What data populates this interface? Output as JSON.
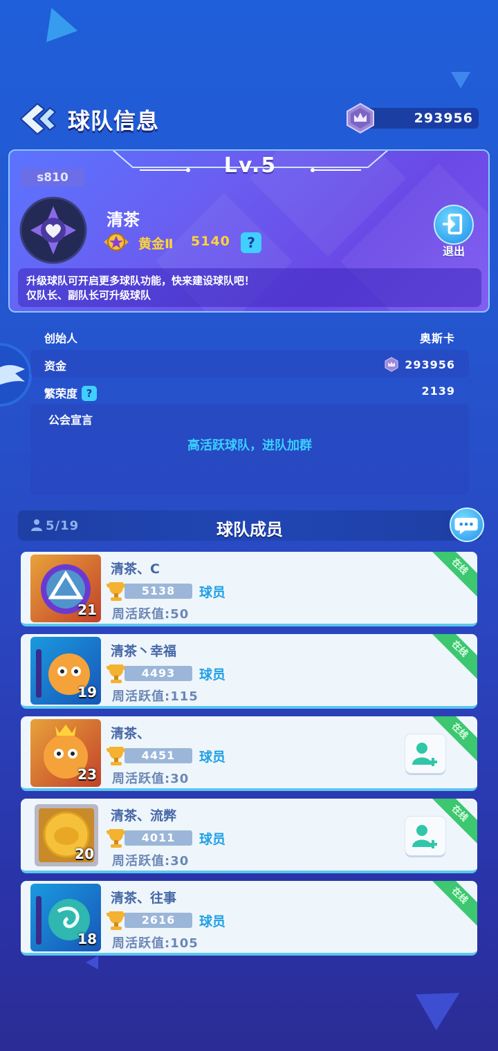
{
  "header": {
    "title": "球队信息",
    "currency_value": "293956"
  },
  "team": {
    "level": "Lv.5",
    "server": "s810",
    "name": "清茶",
    "rank_name": "黄金Ⅱ",
    "rank_score": "5140",
    "help_glyph": "?",
    "exit_label": "退出",
    "notice_lines": [
      "升级球队可开启更多球队功能，快来建设球队吧！",
      "仅队长、副队长可升级球队"
    ]
  },
  "info": {
    "founder_label": "创始人",
    "founder_value": "奥斯卡",
    "funds_label": "资金",
    "funds_value": "293956",
    "prosperity_label": "繁荣度",
    "prosperity_value": "2139",
    "manifesto_label": "公会宣言",
    "manifesto_text": "高活跃球队，进队加群"
  },
  "members_header": {
    "count": "5/19",
    "title": "球队成员"
  },
  "members": [
    {
      "name": "清茶、C",
      "score": "5138",
      "role": "球员",
      "activity": "周活跃值:50",
      "level": "21",
      "status": "在线",
      "avatar": "prism-emblem-icon",
      "show_add": false
    },
    {
      "name": "清茶丶幸福",
      "score": "4493",
      "role": "球员",
      "activity": "周活跃值:115",
      "level": "19",
      "status": "在线",
      "avatar": "tiger-guitar-icon",
      "show_add": false
    },
    {
      "name": "清茶、",
      "score": "4451",
      "role": "球员",
      "activity": "周活跃值:30",
      "level": "23",
      "status": "在线",
      "avatar": "tiger-crown-icon",
      "show_add": true
    },
    {
      "name": "清茶、流弊",
      "score": "4011",
      "role": "球员",
      "activity": "周活跃值:30",
      "level": "20",
      "status": "在线",
      "avatar": "golden-piggy-coin-icon",
      "show_add": true
    },
    {
      "name": "清茶、往事",
      "score": "2616",
      "role": "球员",
      "activity": "周活跃值:105",
      "level": "18",
      "status": "在线",
      "avatar": "dragon-guitar-icon",
      "show_add": false
    }
  ],
  "colors": {
    "accent_cyan": "#39d0ff",
    "gold": "#ffd23a",
    "online_green": "#3cc770",
    "role_blue": "#1fa0e6"
  }
}
